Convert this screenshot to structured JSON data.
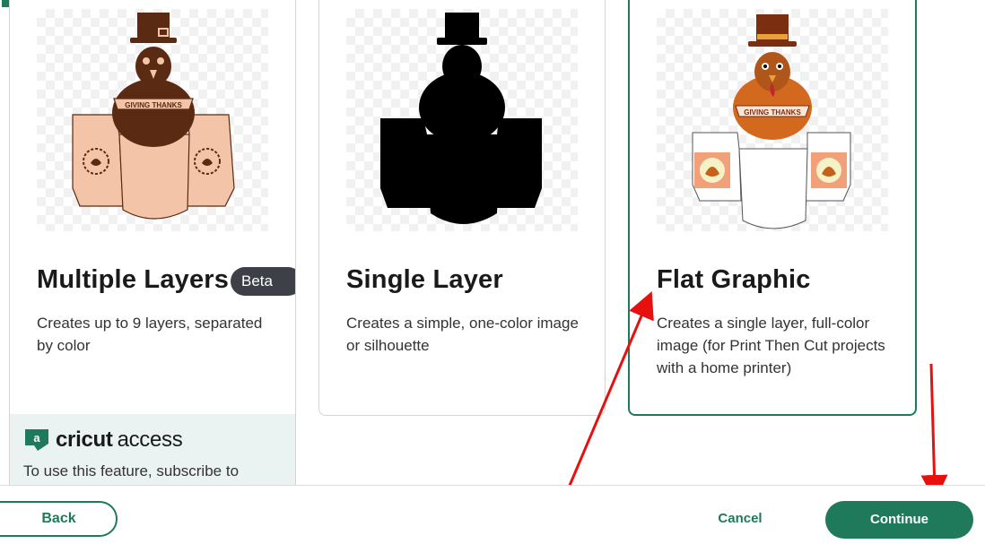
{
  "cards": [
    {
      "title": "Multiple Layers",
      "badge": "Beta",
      "description": "Creates up to 9 layers, separated by color",
      "banner_text": "GIVING THANKS"
    },
    {
      "title": "Single Layer",
      "description": "Creates a simple, one-color image or silhouette"
    },
    {
      "title": "Flat Graphic",
      "description": "Creates a single layer, full-color image (for Print Then Cut projects with a home printer)",
      "banner_text": "GIVING THANKS",
      "selected": true
    }
  ],
  "access": {
    "brand_bold": "cricut",
    "brand_light": "access",
    "text": "To use this feature, subscribe to"
  },
  "footer": {
    "back_label": "Back",
    "cancel_label": "Cancel",
    "continue_label": "Continue"
  },
  "colors": {
    "accent": "#1e7a5a",
    "annotation": "#e8100f"
  },
  "icons": [
    "cricut-access-icon",
    "corner-tag-icon",
    "turkey-layers-icon",
    "turkey-silhouette-icon",
    "turkey-flat-icon"
  ]
}
